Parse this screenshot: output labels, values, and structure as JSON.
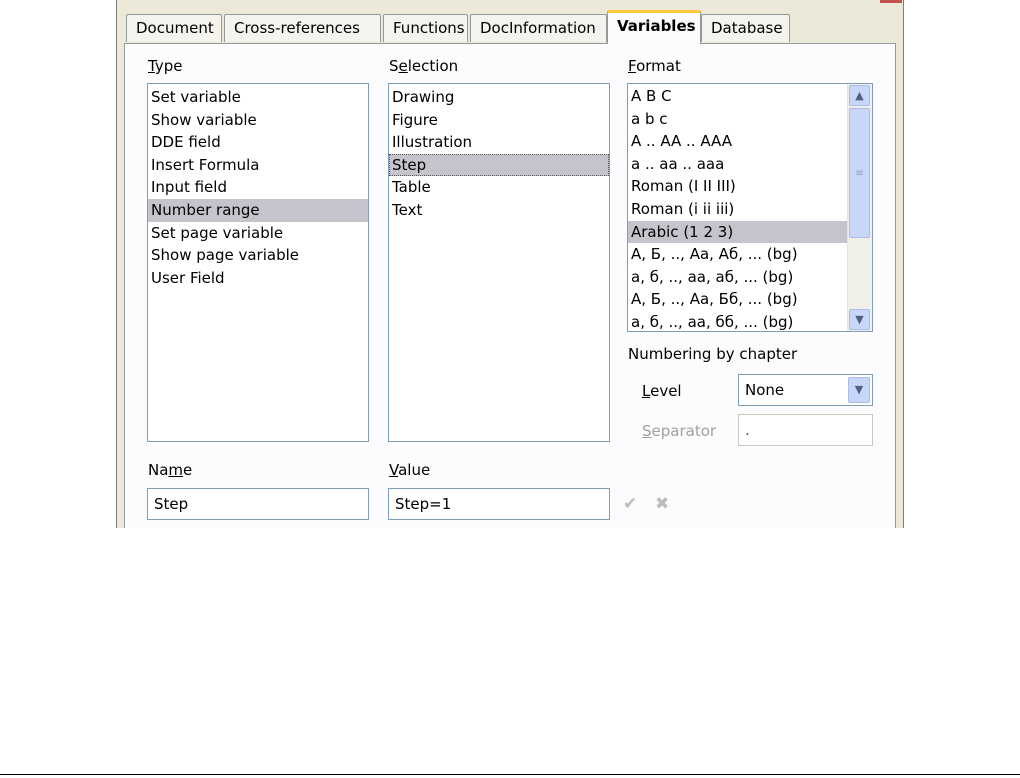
{
  "tabs": [
    "Document",
    "Cross-references",
    "Functions",
    "DocInformation",
    "Variables",
    "Database"
  ],
  "active_tab": "Variables",
  "type": {
    "label_u": "T",
    "label_rest": "ype",
    "items": [
      "Set variable",
      "Show variable",
      "DDE field",
      "Insert Formula",
      "Input field",
      "Number range",
      "Set page variable",
      "Show page variable",
      "User Field"
    ],
    "selected": "Number range"
  },
  "selection": {
    "label_pre": "S",
    "label_u": "e",
    "label_rest": "lection",
    "items": [
      "Drawing",
      "Figure",
      "Illustration",
      "Step",
      "Table",
      "Text"
    ],
    "selected": "Step"
  },
  "format": {
    "label_u": "F",
    "label_rest": "ormat",
    "items": [
      "A B C",
      "a b c",
      "A .. AA .. AAA",
      "a .. aa .. aaa",
      "Roman (I II III)",
      "Roman (i ii iii)",
      "Arabic (1 2 3)",
      "А, Б, .., Аа, Аб, ... (bg)",
      "а, б, .., аа, аб, ... (bg)",
      "А, Б, .., Аа, Бб, ... (bg)",
      "а, б, .., аа, бб, ... (bg)"
    ],
    "selected": "Arabic (1 2 3)"
  },
  "numbering": {
    "heading": "Numbering by chapter",
    "level_u": "L",
    "level_rest": "evel",
    "level_value": "None",
    "separator_u": "S",
    "separator_rest": "eparator",
    "separator_value": "."
  },
  "name": {
    "label_pre": "Na",
    "label_u": "m",
    "label_rest": "e",
    "value": "Step"
  },
  "value": {
    "label_u": "V",
    "label_rest": "alue",
    "value": "Step=1"
  },
  "icons": {
    "apply": "checkmark-icon",
    "delete": "delete-x-icon"
  }
}
